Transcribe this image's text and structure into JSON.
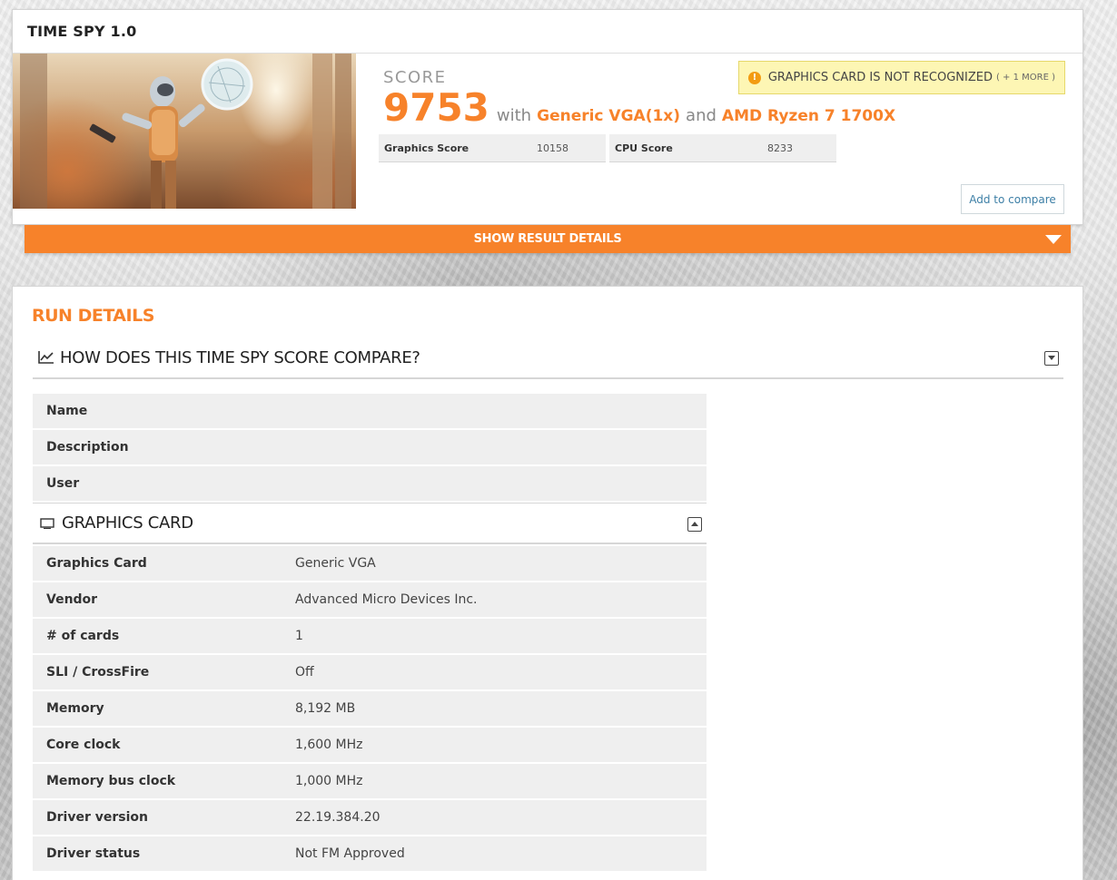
{
  "benchmark": {
    "title": "TIME SPY 1.0",
    "score_label": "SCORE",
    "score": "9753",
    "with_text": "with",
    "gpu": "Generic VGA(1x)",
    "and_text": "and",
    "cpu": "AMD Ryzen 7 1700X",
    "subscores": [
      {
        "label": "Graphics Score",
        "value": "10158"
      },
      {
        "label": "CPU Score",
        "value": "8233"
      }
    ],
    "warning": {
      "text": "GRAPHICS CARD IS NOT RECOGNIZED",
      "more": "( + 1 MORE )",
      "icon": "exclamation-icon"
    },
    "compare_button": "Add to compare",
    "details_bar": "SHOW RESULT DETAILS"
  },
  "run_details": {
    "title": "RUN DETAILS",
    "compare_section": "HOW DOES THIS TIME SPY SCORE COMPARE?",
    "info_rows": [
      {
        "label": "Name",
        "value": ""
      },
      {
        "label": "Description",
        "value": ""
      },
      {
        "label": "User",
        "value": ""
      }
    ],
    "gpu_section": "GRAPHICS CARD",
    "gpu_rows": [
      {
        "label": "Graphics Card",
        "value": "Generic VGA"
      },
      {
        "label": "Vendor",
        "value": "Advanced Micro Devices Inc."
      },
      {
        "label": "# of cards",
        "value": "1"
      },
      {
        "label": "SLI / CrossFire",
        "value": "Off"
      },
      {
        "label": "Memory",
        "value": "8,192 MB"
      },
      {
        "label": "Core clock",
        "value": "1,600 MHz"
      },
      {
        "label": "Memory bus clock",
        "value": "1,000 MHz"
      },
      {
        "label": "Driver version",
        "value": "22.19.384.20"
      },
      {
        "label": "Driver status",
        "value": "Not FM Approved"
      }
    ]
  },
  "colors": {
    "accent": "#f7822a",
    "warning_bg": "#fdf6b4",
    "link": "#3d7fa6"
  }
}
